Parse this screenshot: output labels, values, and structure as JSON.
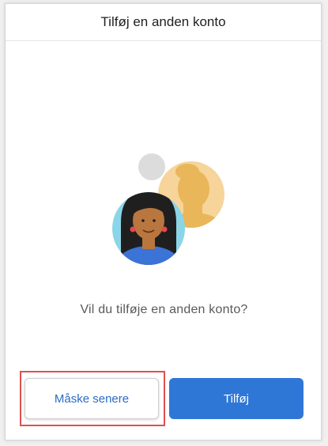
{
  "header": {
    "title": "Tilføj en anden konto"
  },
  "illustration": {
    "icon": "add-account-people-illustration",
    "colors": {
      "grey_circle": "#dcdcdc",
      "back_person_bg": "#f6d49a",
      "back_person_silhouette": "#e9b65a",
      "front_person_bg": "#8ad6e8",
      "front_person_skin": "#b9763f",
      "front_person_hair": "#1f1f1f",
      "front_person_shirt": "#3b73d6"
    }
  },
  "main": {
    "question": "Vil du tilføje en anden konto?"
  },
  "buttons": {
    "later_label": "Måske senere",
    "add_label": "Tilføj"
  },
  "colors": {
    "accent": "#2f77d6",
    "highlight": "#e0504f"
  }
}
